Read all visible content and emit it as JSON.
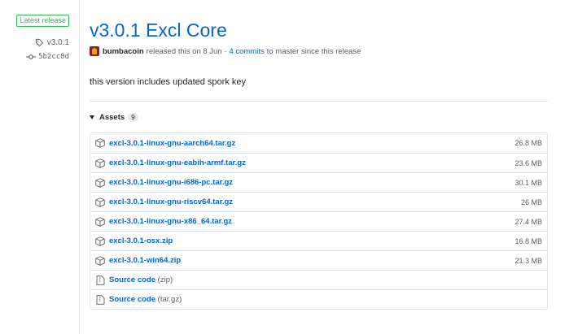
{
  "sidebar": {
    "latest_label": "Latest release",
    "tag": "v3.0.1",
    "commit": "5b2cc0d"
  },
  "release": {
    "title": "v3.0.1 Excl Core",
    "author": "bumbacoin",
    "released_text": "released this on 8 Jun ·",
    "commits_link": "4 commits",
    "since_text": "to master since this release",
    "description": "this version includes updated spork key"
  },
  "assets": {
    "label": "Assets",
    "count": "9",
    "files": [
      {
        "name": "excl-3.0.1-linux-gnu-aarch64.tar.gz",
        "size": "26.8 MB"
      },
      {
        "name": "excl-3.0.1-linux-gnu-eabih-armf.tar.gz",
        "size": "23.6 MB"
      },
      {
        "name": "excl-3.0.1-linux-gnu-i686-pc.tar.gz",
        "size": "30.1 MB"
      },
      {
        "name": "excl-3.0.1-linux-gnu-riscv64.tar.gz",
        "size": "26 MB"
      },
      {
        "name": "excl-3.0.1-linux-gnu-x86_64.tar.gz",
        "size": "27.4 MB"
      },
      {
        "name": "excl-3.0.1-osx.zip",
        "size": "16.8 MB"
      },
      {
        "name": "excl-3.0.1-win64.zip",
        "size": "21.3 MB"
      }
    ],
    "sources": [
      {
        "label": "Source code",
        "suffix": "(zip)"
      },
      {
        "label": "Source code",
        "suffix": "(tar.gz)"
      }
    ]
  },
  "colors": {
    "link": "#0366d6",
    "badge_green": "#2cbe4e",
    "muted": "#586069",
    "border": "#e1e4e8"
  },
  "icons": {
    "tag": "tag-icon",
    "commit": "git-commit-icon",
    "package": "package-icon",
    "file_zip": "file-zip-icon",
    "triangle": "triangle-down-icon"
  }
}
